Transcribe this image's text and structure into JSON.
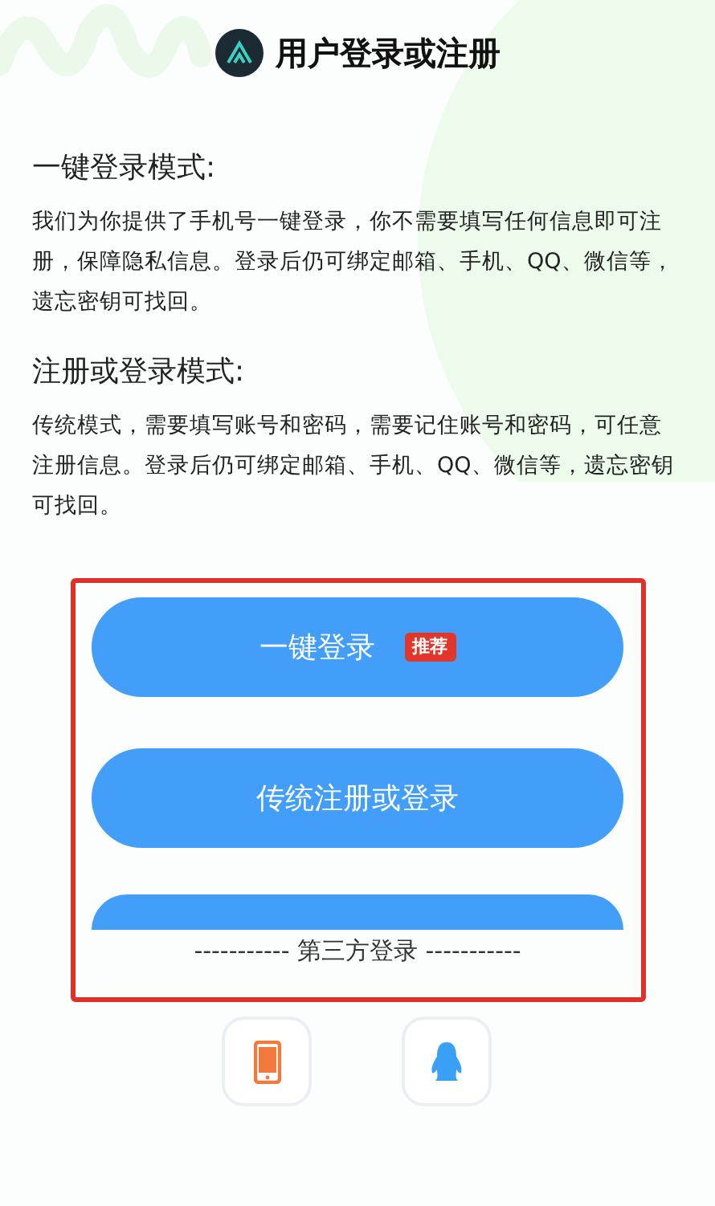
{
  "title": "用户登录或注册",
  "sections": [
    {
      "heading": "一键登录模式:",
      "text": "我们为你提供了手机号一键登录，你不需要填写任何信息即可注册，保障隐私信息。登录后仍可绑定邮箱、手机、QQ、微信等，遗忘密钥可找回。"
    },
    {
      "heading": "注册或登录模式:",
      "text": "传统模式，需要填写账号和密码，需要记住账号和密码，可任意注册信息。登录后仍可绑定邮箱、手机、QQ、微信等，遗忘密钥可找回。"
    }
  ],
  "buttons": [
    {
      "label": "一键登录",
      "badge": "推荐"
    },
    {
      "label": "传统注册或登录"
    }
  ],
  "divider": "----------- 第三方登录 -----------",
  "third_party": [
    {
      "kind": "phone"
    },
    {
      "kind": "qq"
    }
  ]
}
